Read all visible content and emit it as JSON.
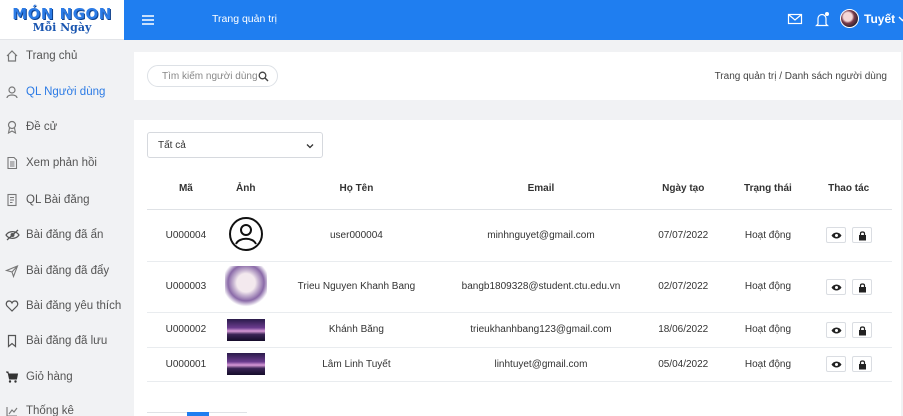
{
  "brand": {
    "line1": "MÓN NGON",
    "line2": "Mỗi Ngày"
  },
  "sidebar": {
    "items": [
      {
        "label": "Trang chủ",
        "icon": "home-icon"
      },
      {
        "label": "QL Người dùng",
        "icon": "user-icon",
        "active": true
      },
      {
        "label": "Đề cử",
        "icon": "badge-icon"
      },
      {
        "label": "Xem phản hồi",
        "icon": "document-icon"
      },
      {
        "label": "QL Bài đăng",
        "icon": "post-icon"
      },
      {
        "label": "Bài đăng đã ẩn",
        "icon": "eye-slash-icon"
      },
      {
        "label": "Bài đăng đã đẩy",
        "icon": "paper-plane-icon"
      },
      {
        "label": "Bài đăng yêu thích",
        "icon": "heart-icon"
      },
      {
        "label": "Bài đăng đã lưu",
        "icon": "bookmark-icon"
      },
      {
        "label": "Giỏ hàng",
        "icon": "cart-icon"
      },
      {
        "label": "Thống kê",
        "icon": "chart-icon"
      }
    ]
  },
  "header": {
    "title": "Trang quản trị",
    "user_name": "Tuyết"
  },
  "search": {
    "placeholder": "Tìm kiếm người dùng..."
  },
  "breadcrumb": "Trang quản trị / Danh sách người dùng",
  "filter": {
    "selected": "Tất cả"
  },
  "table": {
    "headers": [
      "Mã",
      "Ảnh",
      "Họ Tên",
      "Email",
      "Ngày tạo",
      "Trạng thái",
      "Thao tác"
    ],
    "rows": [
      {
        "id": "U000004",
        "avatar": "default-user-icon",
        "name": "user000004",
        "email": "minhnguyet@gmail.com",
        "created": "07/07/2022",
        "status": "Hoạt động"
      },
      {
        "id": "U000003",
        "avatar": "anime-avatar",
        "name": "Trieu Nguyen Khanh Bang",
        "email": "bangb1809328@student.ctu.edu.vn",
        "created": "02/07/2022",
        "status": "Hoạt động"
      },
      {
        "id": "U000002",
        "avatar": "landscape-avatar",
        "name": "Khánh Băng",
        "email": "trieukhanhbang123@gmail.com",
        "created": "18/06/2022",
        "status": "Hoạt động"
      },
      {
        "id": "U000001",
        "avatar": "landscape-avatar",
        "name": "Lâm Linh Tuyết",
        "email": "linhtuyet@gmail.com",
        "created": "05/04/2022",
        "status": "Hoạt động"
      }
    ]
  },
  "colors": {
    "primary": "#1f7ef0",
    "sidebar_bg": "#f1f2f4",
    "active_text": "#2c7be5"
  }
}
